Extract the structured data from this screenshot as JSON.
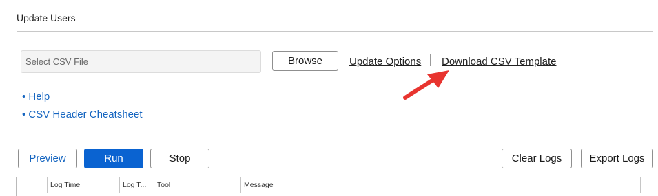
{
  "panel": {
    "title": "Update Users"
  },
  "file_select": {
    "placeholder": "Select CSV File",
    "browse_label": "Browse"
  },
  "links": {
    "update_options": "Update Options",
    "download_template": "Download CSV Template"
  },
  "help_links": [
    {
      "label": "• Help"
    },
    {
      "label": "• CSV Header Cheatsheet"
    }
  ],
  "actions": {
    "preview": "Preview",
    "run": "Run",
    "stop": "Stop",
    "clear_logs": "Clear Logs",
    "export_logs": "Export Logs"
  },
  "log_grid": {
    "columns": [
      "",
      "Log Time",
      "Log T...",
      "Tool",
      "Message"
    ]
  },
  "colors": {
    "accent": "#0a63d1",
    "link_blue": "#1565c0",
    "annotation_arrow": "#e8342f"
  },
  "icons": {
    "annotation": "red-arrow-icon"
  }
}
